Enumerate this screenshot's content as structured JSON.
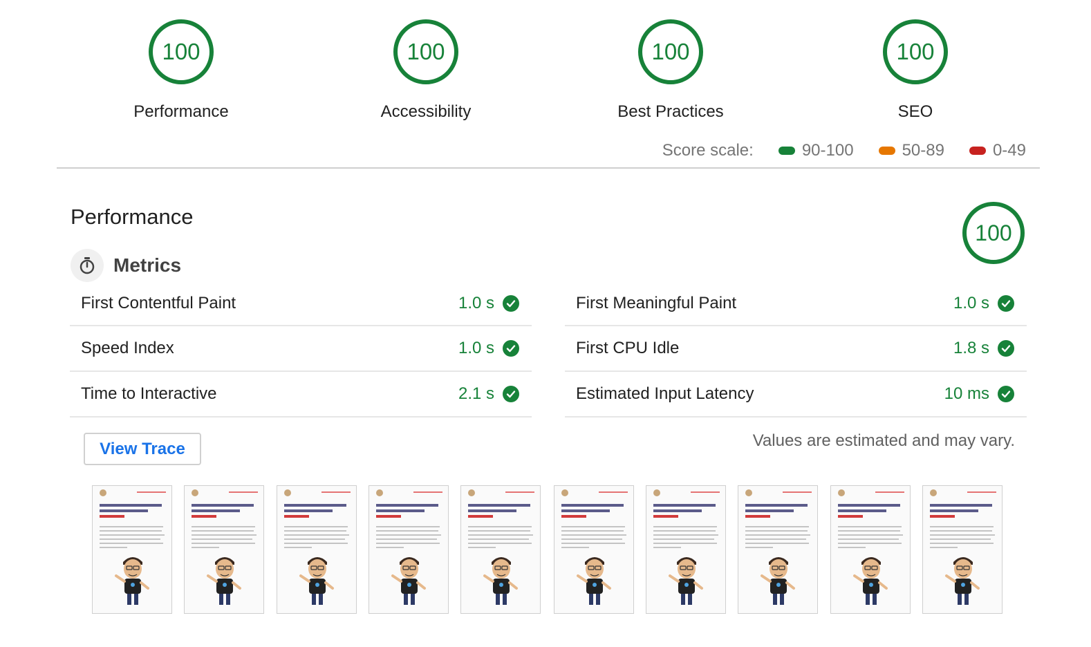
{
  "categories": [
    {
      "score": "100",
      "label": "Performance"
    },
    {
      "score": "100",
      "label": "Accessibility"
    },
    {
      "score": "100",
      "label": "Best Practices"
    },
    {
      "score": "100",
      "label": "SEO"
    }
  ],
  "score_scale": {
    "label": "Score scale:",
    "ranges": [
      {
        "label": "90-100",
        "color": "#178239"
      },
      {
        "label": "50-89",
        "color": "#e67700"
      },
      {
        "label": "0-49",
        "color": "#c7221f"
      }
    ]
  },
  "section": {
    "title": "Performance",
    "score": "100",
    "metrics_title": "Metrics",
    "metrics_icon": "stopwatch-icon"
  },
  "metrics_left": [
    {
      "label": "First Contentful Paint",
      "value": "1.0 s"
    },
    {
      "label": "Speed Index",
      "value": "1.0 s"
    },
    {
      "label": "Time to Interactive",
      "value": "2.1 s"
    }
  ],
  "metrics_right": [
    {
      "label": "First Meaningful Paint",
      "value": "1.0 s"
    },
    {
      "label": "First CPU Idle",
      "value": "1.8 s"
    },
    {
      "label": "Estimated Input Latency",
      "value": "10 ms"
    }
  ],
  "view_trace_label": "View Trace",
  "disclaimer": "Values are estimated and may vary.",
  "colors": {
    "pass": "#178239",
    "link": "#1a73e8"
  },
  "filmstrip_frames": 10
}
